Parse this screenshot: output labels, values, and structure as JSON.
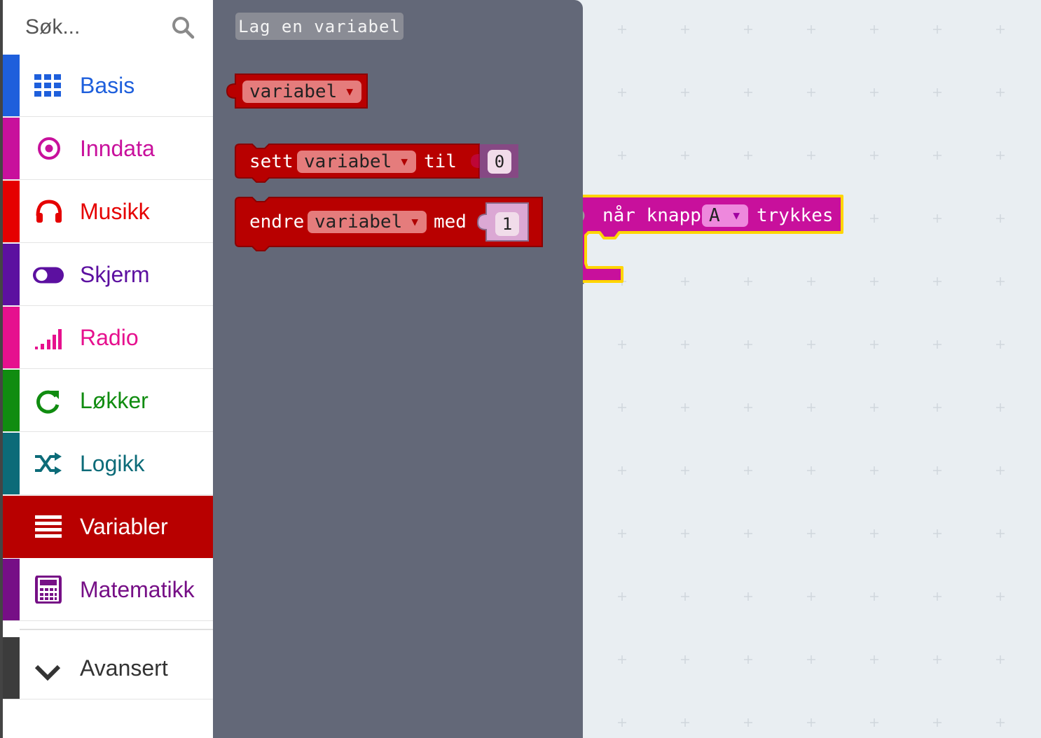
{
  "search": {
    "placeholder": "Søk..."
  },
  "categories": [
    {
      "label": "Basis",
      "color": "#1e5fdc",
      "icon": "grid-icon"
    },
    {
      "label": "Inndata",
      "color": "#c8109c",
      "icon": "target-icon"
    },
    {
      "label": "Musikk",
      "color": "#e50000",
      "icon": "headphones-icon"
    },
    {
      "label": "Skjerm",
      "color": "#5c10a0",
      "icon": "toggle-icon"
    },
    {
      "label": "Radio",
      "color": "#e6108e",
      "icon": "signal-bars-icon"
    },
    {
      "label": "Løkker",
      "color": "#108c10",
      "icon": "refresh-icon"
    },
    {
      "label": "Logikk",
      "color": "#0c6b78",
      "icon": "shuffle-icon"
    },
    {
      "label": "Variabler",
      "color": "#b80000",
      "icon": "lines-icon",
      "selected": true
    },
    {
      "label": "Matematikk",
      "color": "#760f86",
      "icon": "calculator-icon"
    }
  ],
  "advanced": {
    "label": "Avansert",
    "icon": "chevron-down-icon"
  },
  "flyout": {
    "make_variable_label": "Lag en variabel",
    "variable_block": {
      "dropdown": "variabel"
    },
    "set_block": {
      "prefix": "sett",
      "dropdown": "variabel",
      "middle": "til",
      "value": "0"
    },
    "change_block": {
      "prefix": "endre",
      "dropdown": "variabel",
      "middle": "med",
      "value": "1"
    }
  },
  "workspace": {
    "event_block": {
      "prefix": "når knapp",
      "dropdown": "A",
      "suffix": "trykkes"
    }
  },
  "colors": {
    "variables": "#b80000",
    "variables_dark": "#8a0000",
    "input": "#c8109c",
    "highlight": "#ffd500",
    "flyout_bg": "#636878",
    "workspace_bg": "#e9eef2"
  }
}
